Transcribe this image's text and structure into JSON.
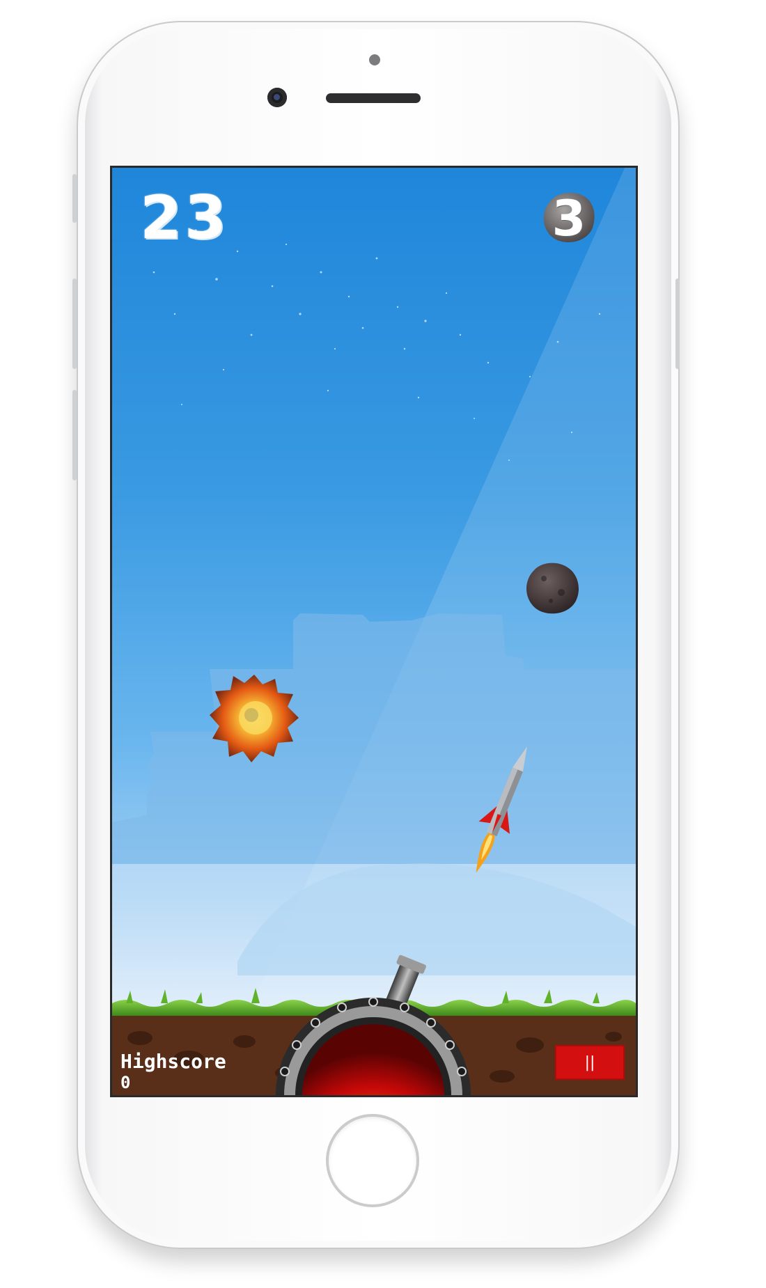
{
  "game": {
    "score": "23",
    "ammo_count": "3",
    "highscore_label": "Highscore",
    "highscore_value": "0",
    "pause_label": "||"
  },
  "colors": {
    "sky_top": "#1f86da",
    "sky_bottom": "#eef6fd",
    "grass": "#5aa628",
    "dirt": "#5a2f1a",
    "pause_button": "#d40f0f",
    "cannon_core": "#e01010"
  },
  "icons": [
    "asteroid-icon",
    "explosion-icon",
    "rocket-icon",
    "cannon-icon",
    "pause-icon"
  ]
}
